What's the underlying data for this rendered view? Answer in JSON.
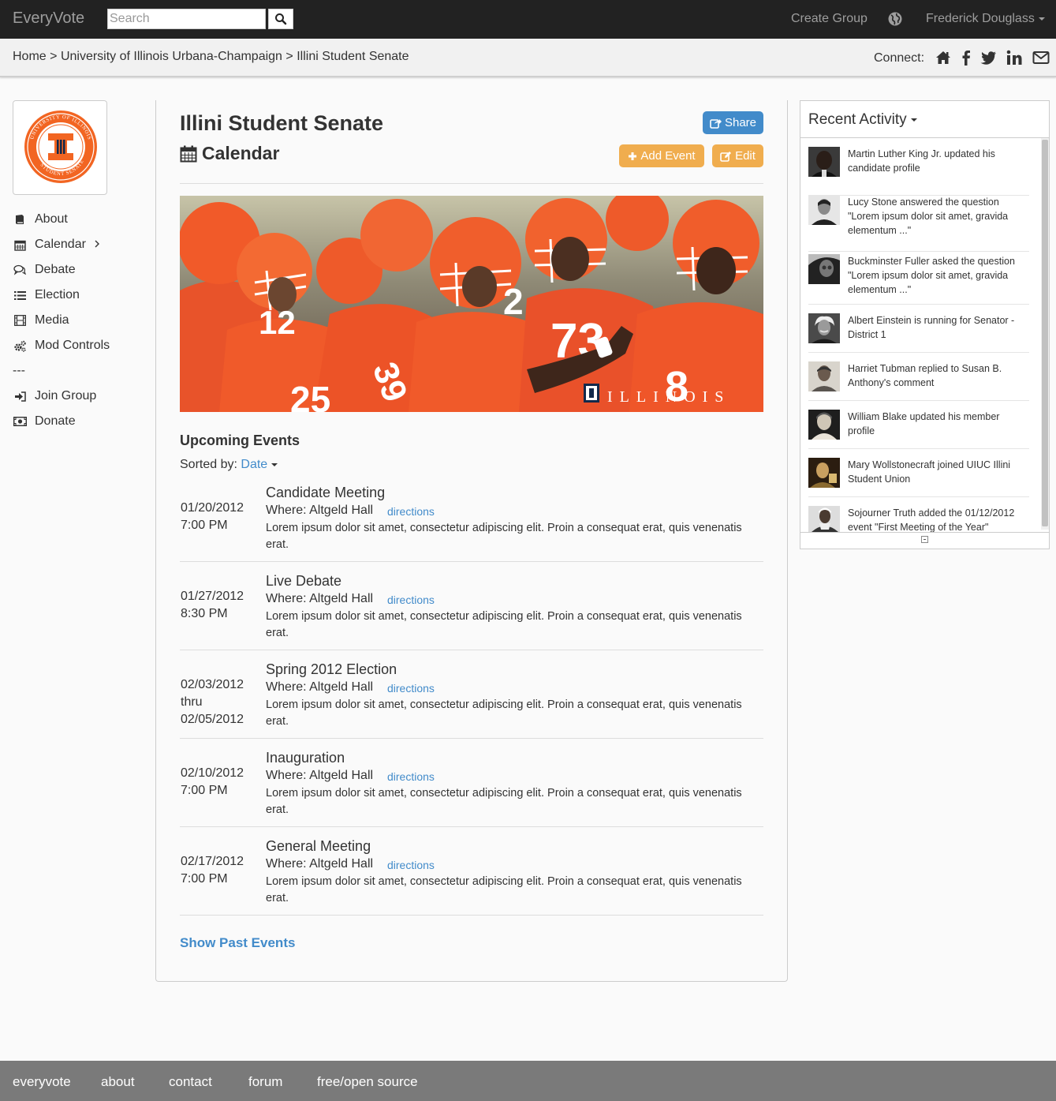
{
  "navbar": {
    "brand": "EveryVote",
    "search_placeholder": "Search",
    "create_group": "Create Group",
    "user_name": "Frederick Douglass"
  },
  "breadcrumb": {
    "home": "Home",
    "sep1": ">",
    "university": "University of Illinois Urbana-Champaign",
    "sep2": ">",
    "group": "Illini Student Senate",
    "connect_label": "Connect:"
  },
  "sidebar": {
    "items": [
      {
        "label": "About",
        "icon": "book-icon"
      },
      {
        "label": "Calendar",
        "icon": "calendar-icon"
      },
      {
        "label": "Debate",
        "icon": "comments-icon"
      },
      {
        "label": "Election",
        "icon": "list-icon"
      },
      {
        "label": "Media",
        "icon": "film-icon"
      },
      {
        "label": "Mod Controls",
        "icon": "cogs-icon"
      },
      {
        "label": "---"
      },
      {
        "label": "Join Group",
        "icon": "sign-in-icon"
      },
      {
        "label": "Donate",
        "icon": "money-icon"
      }
    ]
  },
  "main": {
    "title": "Illini Student Senate",
    "subtitle": "Calendar",
    "share_label": "Share",
    "add_event_label": "Add Event",
    "edit_label": "Edit",
    "banner_text": "ILLINOIS",
    "banner_jerseys": [
      "12",
      "2",
      "73",
      "8",
      "25",
      "39"
    ],
    "upcoming_label": "Upcoming Events",
    "sorted_label": "Sorted by:",
    "sorted_value": "Date",
    "events": [
      {
        "date_line1": "01/20/2012",
        "date_line2": "7:00 PM",
        "date_line3": "",
        "title": "Candidate Meeting",
        "where": "Where: Altgeld Hall",
        "directions": "directions",
        "description": "Lorem ipsum dolor sit amet, consectetur adipiscing elit. Proin a consequat erat, quis venenatis erat."
      },
      {
        "date_line1": "01/27/2012",
        "date_line2": "8:30 PM",
        "date_line3": "",
        "title": "Live Debate",
        "where": "Where: Altgeld Hall",
        "directions": "directions",
        "description": "Lorem ipsum dolor sit amet, consectetur adipiscing elit. Proin a consequat erat, quis venenatis erat."
      },
      {
        "date_line1": "02/03/2012",
        "date_line2": "thru",
        "date_line3": "02/05/2012",
        "title": "Spring 2012 Election",
        "where": "Where: Altgeld Hall",
        "directions": "directions",
        "description": "Lorem ipsum dolor sit amet, consectetur adipiscing elit. Proin a consequat erat, quis venenatis erat."
      },
      {
        "date_line1": "02/10/2012",
        "date_line2": "7:00 PM",
        "date_line3": "",
        "title": "Inauguration",
        "where": "Where: Altgeld Hall",
        "directions": "directions",
        "description": "Lorem ipsum dolor sit amet, consectetur adipiscing elit. Proin a consequat erat, quis venenatis erat."
      },
      {
        "date_line1": "02/17/2012",
        "date_line2": "7:00 PM",
        "date_line3": "",
        "title": "General Meeting",
        "where": "Where: Altgeld Hall",
        "directions": "directions",
        "description": "Lorem ipsum dolor sit amet, consectetur adipiscing elit. Proin a consequat erat, quis venenatis erat."
      }
    ],
    "show_past": "Show Past Events"
  },
  "activity": {
    "title": "Recent Activity",
    "items": [
      {
        "text": "Martin Luther King Jr. updated his candidate profile"
      },
      {
        "text": "Lucy Stone answered the question \"Lorem ipsum dolor sit amet, gravida elementum ...\""
      },
      {
        "text": "Buckminster Fuller asked the question \"Lorem ipsum dolor sit amet, gravida elementum ...\""
      },
      {
        "text": "Albert Einstein is running for Senator - District 1"
      },
      {
        "text": "Harriet Tubman replied to Susan B. Anthony's comment"
      },
      {
        "text": "William Blake updated his member profile"
      },
      {
        "text": "Mary Wollstonecraft joined UIUC Illini Student Union"
      },
      {
        "text": "Sojourner Truth added the 01/12/2012 event \"First Meeting of the Year\""
      }
    ]
  },
  "footer": {
    "links": [
      "everyvote",
      "about",
      "contact",
      "forum",
      "free/open source"
    ]
  },
  "colors": {
    "navbar_bg": "#222222",
    "link_blue": "#428bca",
    "share_blue": "#428bca",
    "warning_orange": "#f0ad4e",
    "illinois_orange": "#f26522",
    "footer_bg": "#7a7a7a"
  }
}
